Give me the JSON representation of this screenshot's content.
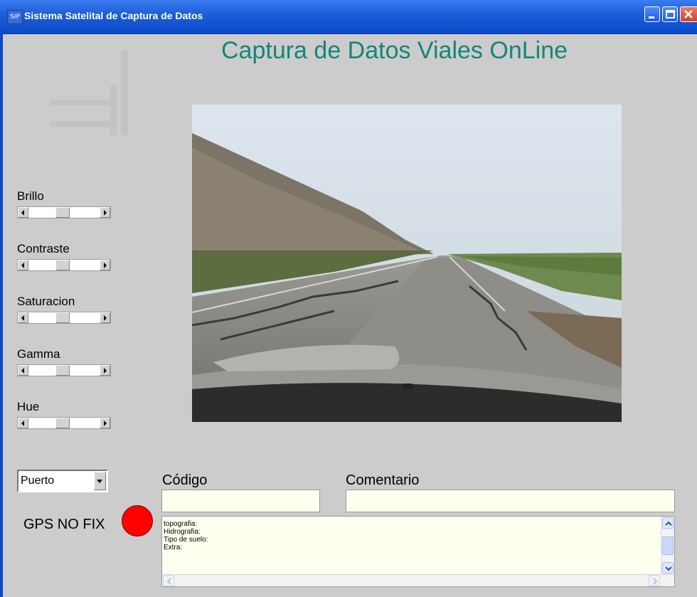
{
  "window": {
    "title": "Sistema Satelital de Captura de Datos",
    "icon_text": "SIP"
  },
  "header": {
    "title": "Captura de Datos Viales OnLine"
  },
  "photo": {
    "alt": "road photo"
  },
  "sliders": [
    {
      "label": "Brillo",
      "level": 0.47
    },
    {
      "label": "Contraste",
      "level": 0.47
    },
    {
      "label": "Saturacion",
      "level": 0.47
    },
    {
      "label": "Gamma",
      "level": 0.47
    },
    {
      "label": "Hue",
      "level": 0.47
    }
  ],
  "port": {
    "selected": "Puerto"
  },
  "gps": {
    "status": "GPS NO FIX",
    "led_color": "#ff0000"
  },
  "form": {
    "codigo_label": "Código",
    "codigo_value": "",
    "comentario_label": "Comentario",
    "comentario_value": ""
  },
  "memo": {
    "lines": [
      "topografia:",
      "Hidrografia:",
      "Tipo de suelo:",
      "Extra:"
    ]
  },
  "colors": {
    "header_title": "#14857a",
    "titlebar": "#0a4ac9",
    "window_bg": "#cccccc"
  }
}
